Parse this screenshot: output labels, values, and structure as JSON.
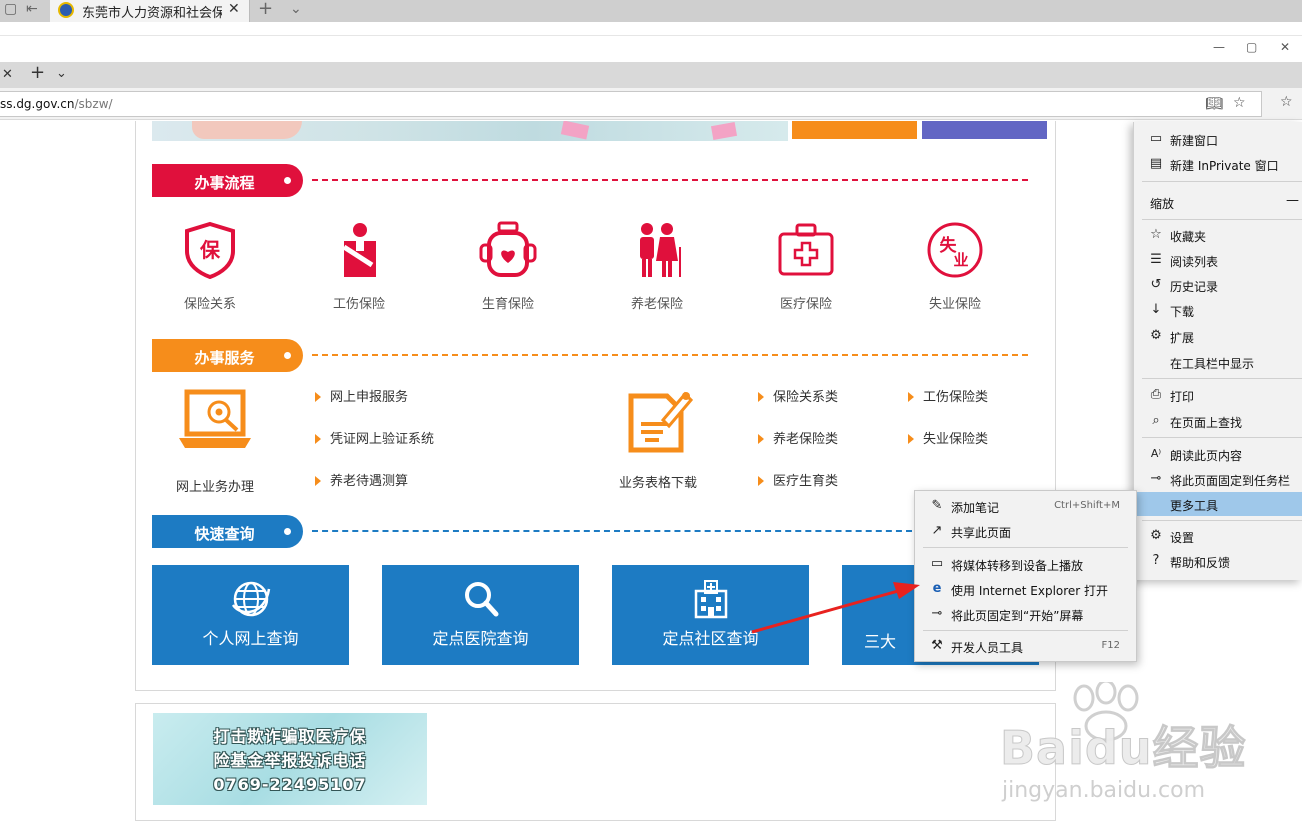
{
  "browser": {
    "outer_tab_title": "东莞市人力资源和社会保",
    "url_host": "ss.dg.gov.cn",
    "url_path": "/sbzw/"
  },
  "page": {
    "sections": {
      "process": {
        "title": "办事流程",
        "color": "#e0103c"
      },
      "service": {
        "title": "办事服务",
        "color": "#f68d1b"
      },
      "query": {
        "title": "快速查询",
        "color": "#1d7bc3"
      }
    },
    "process_items": [
      {
        "label": "保险关系",
        "icon": "shield-bao-icon"
      },
      {
        "label": "工伤保险",
        "icon": "injured-worker-icon"
      },
      {
        "label": "生育保险",
        "icon": "baby-bottle-icon"
      },
      {
        "label": "养老保险",
        "icon": "elderly-couple-icon"
      },
      {
        "label": "医疗保险",
        "icon": "medical-kit-icon"
      },
      {
        "label": "失业保险",
        "icon": "circle-shiye-icon"
      }
    ],
    "online_business_label": "网上业务办理",
    "service_links_left": [
      "网上申报服务",
      "凭证网上验证系统",
      "养老待遇测算"
    ],
    "form_download_label": "业务表格下载",
    "service_links_right_col1": [
      "保险关系类",
      "养老保险类",
      "医疗生育类"
    ],
    "service_links_right_col2": [
      "工伤保险类",
      "失业保险类"
    ],
    "quick_query": [
      {
        "label": "个人网上查询",
        "icon": "globe-icon"
      },
      {
        "label": "定点医院查询",
        "icon": "search-icon"
      },
      {
        "label": "定点社区查询",
        "icon": "hospital-building-icon"
      },
      {
        "label": "三大",
        "icon": ""
      }
    ],
    "ad_lines": [
      "打击欺诈骗取医疗保",
      "险基金举报投诉电话",
      "0769-22495107"
    ]
  },
  "main_menu": {
    "items": [
      {
        "label": "新建窗口",
        "icon": "window-icon"
      },
      {
        "label": "新建 InPrivate 窗口",
        "icon": "inprivate-icon"
      },
      {
        "label": "缩放",
        "icon": ""
      },
      {
        "label": "收藏夹",
        "icon": "favorites-icon"
      },
      {
        "label": "阅读列表",
        "icon": "reading-list-icon"
      },
      {
        "label": "历史记录",
        "icon": "history-icon"
      },
      {
        "label": "下载",
        "icon": "download-icon"
      },
      {
        "label": "扩展",
        "icon": "extensions-icon"
      },
      {
        "label": "在工具栏中显示",
        "icon": ""
      },
      {
        "label": "打印",
        "icon": "print-icon"
      },
      {
        "label": "在页面上查找",
        "icon": "find-icon"
      },
      {
        "label": "朗读此页内容",
        "icon": "read-aloud-icon"
      },
      {
        "label": "将此页面固定到任务栏",
        "icon": "pin-icon"
      },
      {
        "label": "更多工具",
        "icon": ""
      },
      {
        "label": "设置",
        "icon": "settings-icon"
      },
      {
        "label": "帮助和反馈",
        "icon": "help-icon"
      }
    ],
    "zoom_minus": "—"
  },
  "sub_menu": {
    "items": [
      {
        "label": "添加笔记",
        "shortcut": "Ctrl+Shift+M",
        "icon": "pen-icon"
      },
      {
        "label": "共享此页面",
        "shortcut": "",
        "icon": "share-icon"
      },
      {
        "label": "将媒体转移到设备上播放",
        "shortcut": "",
        "icon": "cast-icon"
      },
      {
        "label": "使用 Internet Explorer 打开",
        "shortcut": "",
        "icon": "ie-icon"
      },
      {
        "label": "将此页固定到“开始”屏幕",
        "shortcut": "",
        "icon": "pin-start-icon"
      },
      {
        "label": "开发人员工具",
        "shortcut": "F12",
        "icon": "devtools-icon"
      }
    ]
  },
  "watermark": {
    "big": "Baidu经验",
    "small": "jingyan.baidu.com"
  },
  "colors": {
    "red": "#e0103c",
    "orange": "#f68d1b",
    "blue": "#1d7bc3",
    "highlight": "#9fc8ea"
  }
}
